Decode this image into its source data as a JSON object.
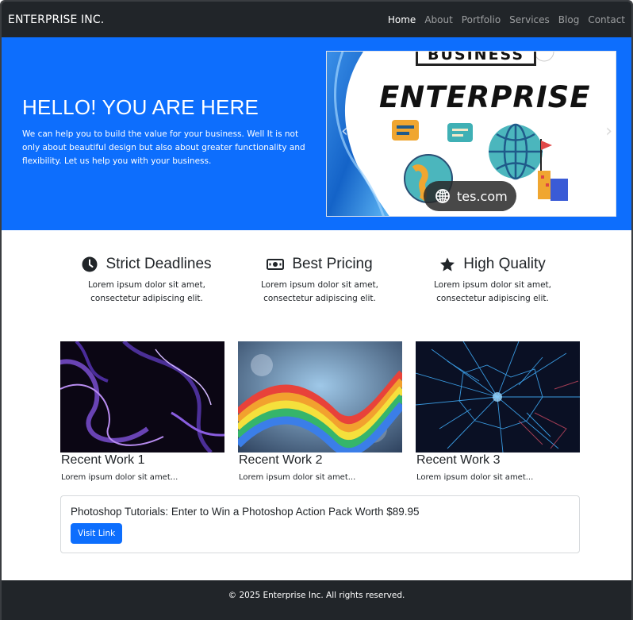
{
  "navbar": {
    "brand": "ENTERPRISE INC.",
    "links": [
      {
        "label": "Home",
        "active": true
      },
      {
        "label": "About"
      },
      {
        "label": "Portfolio"
      },
      {
        "label": "Services"
      },
      {
        "label": "Blog"
      },
      {
        "label": "Contact"
      }
    ]
  },
  "hero": {
    "title": "HELLO! YOU ARE HERE",
    "lead": "We can help you to build the value for your business. Well It is not only about beautiful design but also about greater functionality and flexibility. Let us help you with your business.",
    "carousel": {
      "prev_icon": "‹",
      "next_icon": "›",
      "slide_heading": "ENTERPRISE",
      "slide_tag": "BUSINESS",
      "watermark": "tes.com"
    }
  },
  "features": [
    {
      "icon": "clock-icon",
      "title": "Strict Deadlines",
      "text": "Lorem ipsum dolor sit amet, consectetur adipiscing elit."
    },
    {
      "icon": "cash-icon",
      "title": "Best Pricing",
      "text": "Lorem ipsum dolor sit amet, consectetur adipiscing elit."
    },
    {
      "icon": "star-icon",
      "title": "High Quality",
      "text": "Lorem ipsum dolor sit amet, consectetur adipiscing elit."
    }
  ],
  "works": [
    {
      "title": "Recent Work 1",
      "text": "Lorem ipsum dolor sit amet..."
    },
    {
      "title": "Recent Work 2",
      "text": "Lorem ipsum dolor sit amet..."
    },
    {
      "title": "Recent Work 3",
      "text": "Lorem ipsum dolor sit amet..."
    }
  ],
  "rss": {
    "title": "Photoshop Tutorials: Enter to Win a Photoshop Action Pack Worth $89.95",
    "button_label": "Visit Link"
  },
  "footer": {
    "text": "© 2025 Enterprise Inc. All rights reserved."
  },
  "colors": {
    "primary": "#0d6efd",
    "dark": "#212529"
  }
}
